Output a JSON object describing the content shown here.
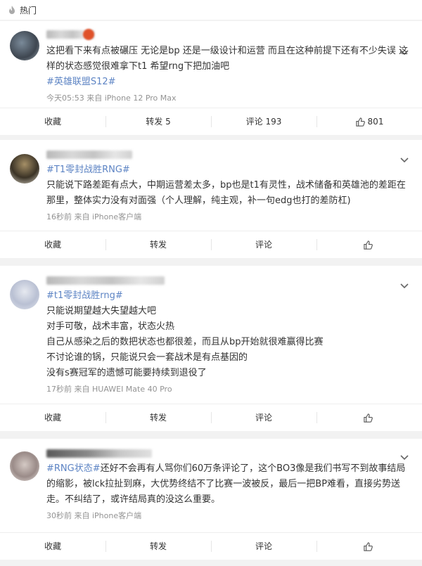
{
  "header": {
    "title": "热门"
  },
  "posts": [
    {
      "text_plain": "这把看下来有点被碾压 无论是bp 还是一级设计和运营 而且在这种前提下还有不少失误 这样的状态感觉很难拿下t1 希望rng下把加油吧",
      "topic": "#英雄联盟S12#",
      "time": "今天05:53",
      "source": "来自 iPhone 12 Pro Max",
      "actions": {
        "fav": "收藏",
        "repost": "转发 5",
        "comment": "评论 193",
        "like": "801"
      }
    },
    {
      "topic": "#T1零封战胜RNG#",
      "text_plain": "只能说下路差距有点大，中期运营差太多，bp也是t1有灵性，战术储备和英雄池的差距在那里，整体实力没有对面强（个人理解，纯主观，补一句edg也打的差防杠)",
      "time": "16秒前",
      "source": "来自 iPhone客户端",
      "actions": {
        "fav": "收藏",
        "repost": "转发",
        "comment": "评论",
        "like": ""
      }
    },
    {
      "topic": "#t1零封战胜rng#",
      "lines": [
        "只能说期望越大失望越大吧",
        "对手可敬，战术丰富，状态火热",
        "自己从感染之后的数把状态也都很差，而且从bp开始就很难赢得比赛",
        "不讨论谁的锅，只能说只会一套战术是有点基因的",
        "没有s赛冠军的遗憾可能要持续到退役了"
      ],
      "time": "17秒前",
      "source": "来自 HUAWEI Mate 40 Pro",
      "actions": {
        "fav": "收藏",
        "repost": "转发",
        "comment": "评论",
        "like": ""
      }
    },
    {
      "topic": "#RNG状态#",
      "text_plain": "还好不会再有人骂你们60万条评论了，这个BO3像是我们书写不到故事结局的缩影，被lck拉扯到麻，大优势终结不了比赛一波被反，最后一把BP难看，直接劣势送走。不纠结了，或许结局真的没这么重要。",
      "time": "30秒前",
      "source": "来自 iPhone客户端",
      "actions": {
        "fav": "收藏",
        "repost": "转发",
        "comment": "评论",
        "like": ""
      }
    }
  ],
  "colors": {
    "topic": "#5d84c4",
    "meta": "#939393",
    "bg": "#f2f2f2"
  }
}
